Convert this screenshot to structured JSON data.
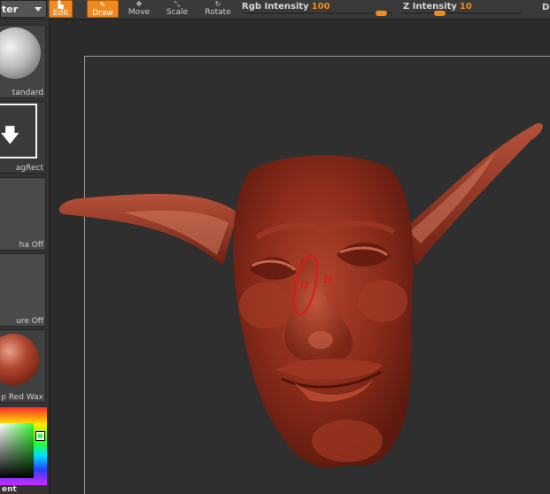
{
  "toolbar": {
    "menu_label": "ter",
    "edit_label": "Edit",
    "draw_label": "Draw",
    "move_label": "Move",
    "scale_label": "Scale",
    "rotate_label": "Rotate",
    "rgb_intensity_label": "Rgb  Intensity",
    "rgb_intensity_value": "100",
    "z_intensity_label": "Z  Intensity",
    "z_intensity_value": "10",
    "edge_letter": "D"
  },
  "shelf": {
    "brush_label": "tandard",
    "stroke_label": "agRect",
    "alpha_label": "ha  Off",
    "texture_label": "ure  Off",
    "material_label": "p Red Wax",
    "bottom_label": "ent"
  },
  "colors": {
    "accent": "#f08a1e",
    "sculpt_base": "#8e2c1c",
    "cursor_ring": "#e01818"
  },
  "icons": {
    "brush": "standard-brush-sphere-icon",
    "stroke": "drag-rect-stroke-icon",
    "material": "red-wax-material-sphere-icon"
  }
}
